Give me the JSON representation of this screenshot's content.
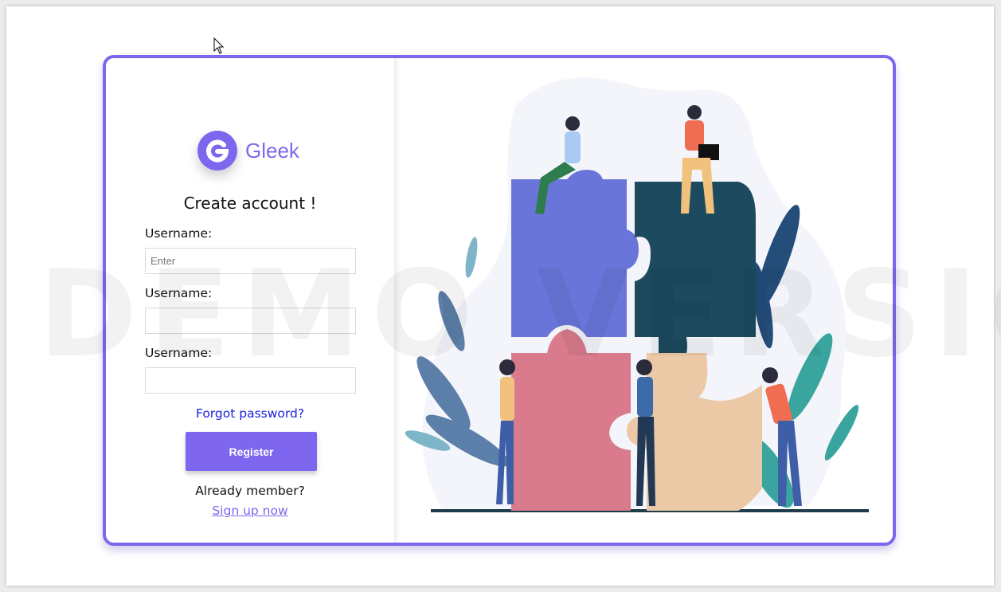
{
  "watermark": "DEMO VERSION",
  "logo": {
    "letter": "G",
    "name": "Gleek"
  },
  "form": {
    "title": "Create account !",
    "fields": [
      {
        "label": "Username:",
        "placeholder": "Enter",
        "value": ""
      },
      {
        "label": "Username:",
        "placeholder": "",
        "value": ""
      },
      {
        "label": "Username:",
        "placeholder": "",
        "value": ""
      }
    ],
    "forgot_link": "Forgot password?",
    "register_label": "Register",
    "already_member": "Already member?",
    "signup_link": "Sign up now"
  },
  "colors": {
    "accent": "#7e67ee",
    "link": "#1a1fd9"
  },
  "illustration": {
    "subject": "people-assembling-puzzle"
  }
}
